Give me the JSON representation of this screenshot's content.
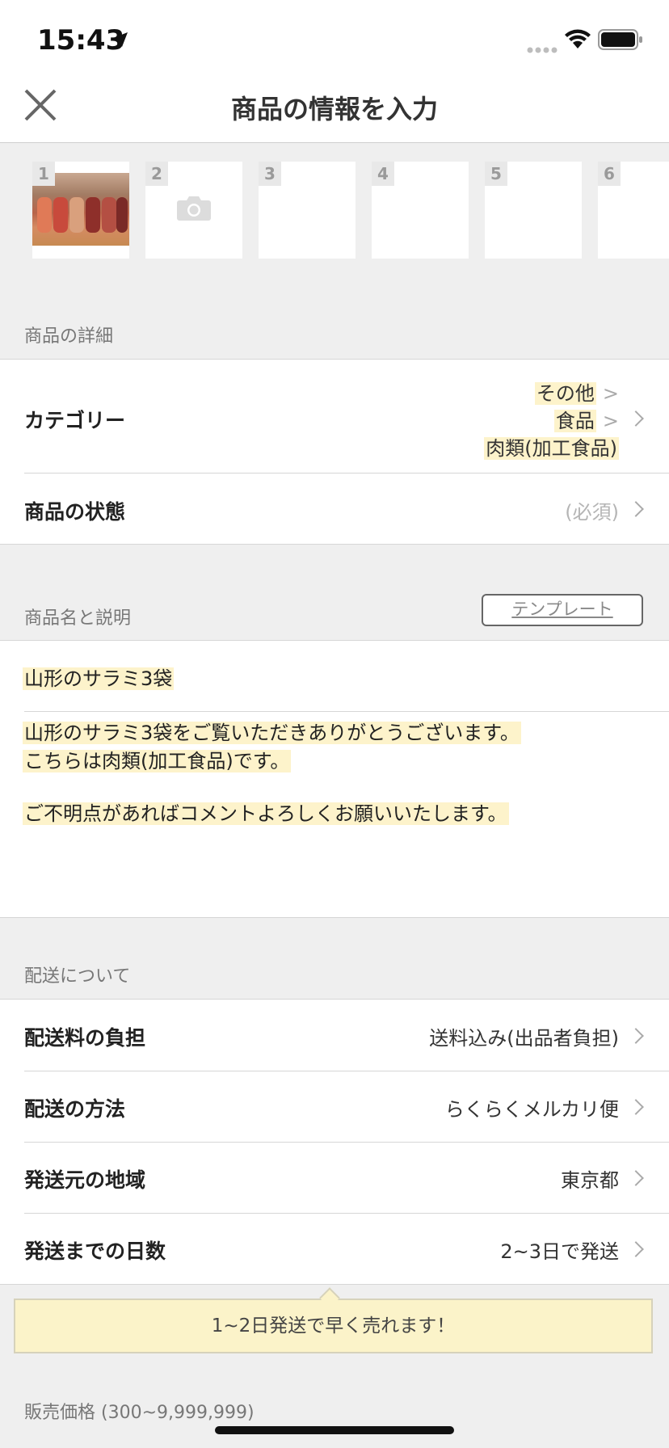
{
  "status_bar": {
    "time": "15:43"
  },
  "nav": {
    "title": "商品の情報を入力"
  },
  "photos": {
    "slots": [
      "1",
      "2",
      "3",
      "4",
      "5",
      "6"
    ]
  },
  "details_section": {
    "header": "商品の詳細",
    "category_label": "カテゴリー",
    "category_path": [
      "その他",
      "食品",
      "肉類(加工食品)"
    ],
    "category_separator": ">",
    "condition_label": "商品の状態",
    "condition_value": "(必須)"
  },
  "name_section": {
    "header": "商品名と説明",
    "template_button": "テンプレート",
    "item_name": "山形のサラミ3袋",
    "description_lines": [
      "山形のサラミ3袋をご覧いただきありがとうございます。",
      "こちらは肉類(加工食品)です。",
      "",
      "ご不明点があればコメントよろしくお願いいたします。"
    ]
  },
  "shipping_section": {
    "header": "配送について",
    "rows": [
      {
        "label": "配送料の負担",
        "value": "送料込み(出品者負担)"
      },
      {
        "label": "配送の方法",
        "value": "らくらくメルカリ便"
      },
      {
        "label": "発送元の地域",
        "value": "東京都"
      },
      {
        "label": "発送までの日数",
        "value": "2~3日で発送"
      }
    ],
    "tip": "1~2日発送で早く売れます！"
  },
  "price_section": {
    "header": "販売価格 (300~9,999,999)"
  },
  "colors": {
    "highlight": "#fdf3cb",
    "tip_bg": "#fbf3c9",
    "bg_gray": "#efefef"
  }
}
